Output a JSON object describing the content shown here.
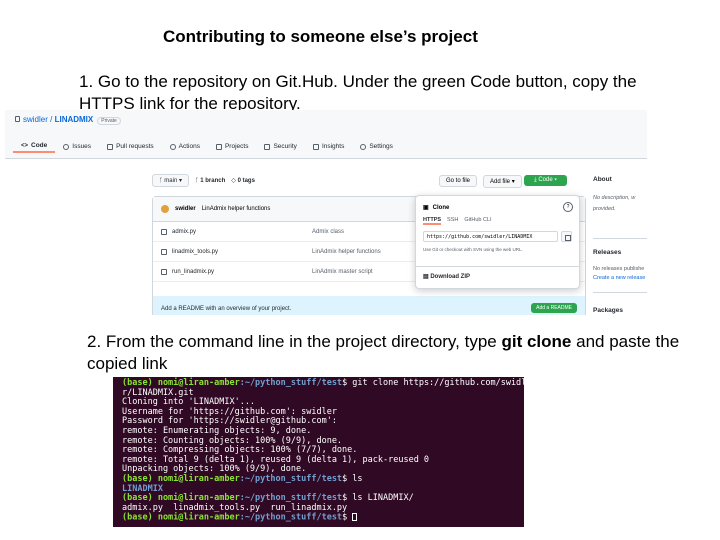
{
  "slide": {
    "title": "Contributing to someone else’s project",
    "step1": "1. Go to the repository on Git.Hub. Under the green Code button, copy the HTTPS link for the repository.",
    "step2_prefix": "2. From the command line in the project directory, type ",
    "step2_bold": "git clone",
    "step2_suffix": " and paste the copied link"
  },
  "github": {
    "owner": "swidler",
    "repo": "LINADMIX",
    "visibility": "Private",
    "tabs": [
      "Code",
      "Issues",
      "Pull requests",
      "Actions",
      "Projects",
      "Security",
      "Insights",
      "Settings"
    ],
    "branch": "main",
    "branches": "1 branch",
    "tags": "0 tags",
    "go_to_file": "Go to file",
    "add_file": "Add file",
    "code_button": "Code",
    "commit_author": "swidler",
    "commit_message": "LinAdmix helper functions",
    "files": [
      {
        "name": "admix.py",
        "message": "Admix class"
      },
      {
        "name": "linadmix_tools.py",
        "message": "LinAdmix helper functions"
      },
      {
        "name": "run_linadmix.py",
        "message": "LinAdmix master script"
      }
    ],
    "readme_prompt": "Add a README with an overview of your project.",
    "readme_button": "Add a README",
    "clone": {
      "title": "Clone",
      "tabs": [
        "HTTPS",
        "SSH",
        "GitHub CLI"
      ],
      "url": "https://github.com/swidler/LINADMIX",
      "hint": "Use Git or checkout with SVN using the web URL.",
      "download": "Download ZIP"
    },
    "sidebar": {
      "about": "About",
      "about_text_1": "No description, w",
      "about_text_2": "provided.",
      "releases": "Releases",
      "releases_text_1": "No releases publishe",
      "releases_text_2": "Create a new release",
      "packages": "Packages"
    }
  },
  "terminal": {
    "lines": [
      {
        "prompt_user": "(base) nomi@liran-amber",
        "prompt_path": ":~/python_stuff/test",
        "cmd": "$ git clone https://github.com/swidle"
      },
      {
        "text": "r/LINADMIX.git"
      },
      {
        "text": "Cloning into 'LINADMIX'..."
      },
      {
        "text": "Username for 'https://github.com': swidler"
      },
      {
        "text": "Password for 'https://swidler@github.com':"
      },
      {
        "text": "remote: Enumerating objects: 9, done."
      },
      {
        "text": "remote: Counting objects: 100% (9/9), done."
      },
      {
        "text": "remote: Compressing objects: 100% (7/7), done."
      },
      {
        "text": "remote: Total 9 (delta 1), reused 9 (delta 1), pack-reused 0"
      },
      {
        "text": "Unpacking objects: 100% (9/9), done."
      },
      {
        "prompt_user": "(base) nomi@liran-amber",
        "prompt_path": ":~/python_stuff/test",
        "cmd": "$ ls"
      },
      {
        "dir": "LINADMIX"
      },
      {
        "prompt_user": "(base) nomi@liran-amber",
        "prompt_path": ":~/python_stuff/test",
        "cmd": "$ ls LINADMIX/"
      },
      {
        "text": "admix.py  linadmix_tools.py  run_linadmix.py"
      },
      {
        "prompt_user": "(base) nomi@liran-amber",
        "prompt_path": ":~/python_stuff/test",
        "cmd": "$ "
      }
    ]
  }
}
